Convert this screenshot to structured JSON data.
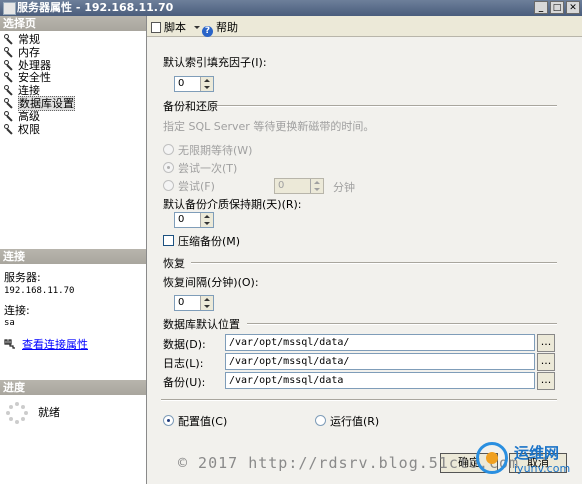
{
  "window": {
    "title": "服务器属性 - 192.168.11.70"
  },
  "left": {
    "select_page_header": "选择页",
    "pages": [
      "常规",
      "内存",
      "处理器",
      "安全性",
      "连接",
      "数据库设置",
      "高级",
      "权限"
    ],
    "selected_page": "数据库设置",
    "connection_header": "连接",
    "server_label": "服务器:",
    "server_value": "192.168.11.70",
    "connection_label": "连接:",
    "connection_value": "sa",
    "view_connection_link": "查看连接属性",
    "progress_header": "进度",
    "progress_status": "就绪"
  },
  "toolbar": {
    "script_label": "脚本",
    "help_label": "帮助"
  },
  "settings": {
    "fill_factor_label": "默认索引填充因子(I):",
    "fill_factor_value": "0",
    "backup_restore_header": "备份和还原",
    "tape_prompt_label": "指定 SQL Server 等待更换新磁带的时间。",
    "wait_forever_label": "无限期等待(W)",
    "try_once_label": "尝试一次(T)",
    "try_for_label": "尝试(F)",
    "try_minutes_value": "0",
    "minutes_label": "分钟",
    "retention_label": "默认备份介质保持期(天)(R):",
    "retention_value": "0",
    "compress_label": "压缩备份(M)",
    "recovery_header": "恢复",
    "recovery_interval_label": "恢复间隔(分钟)(O):",
    "recovery_interval_value": "0",
    "db_default_location_header": "数据库默认位置",
    "data_label": "数据(D):",
    "data_value": "/var/opt/mssql/data/",
    "log_label": "日志(L):",
    "log_value": "/var/opt/mssql/data/",
    "backup_label": "备份(U):",
    "backup_value": "/var/opt/mssql/data",
    "browse_label": "...",
    "configured_values_label": "配置值(C)",
    "running_values_label": "运行值(R)"
  },
  "buttons": {
    "ok_label": "确定",
    "cancel_label": "取消"
  },
  "watermark": {
    "text": "© 2017 http://rdsrv.blog.51cto.com",
    "brand": "运维网",
    "site": "iyunv.com"
  }
}
